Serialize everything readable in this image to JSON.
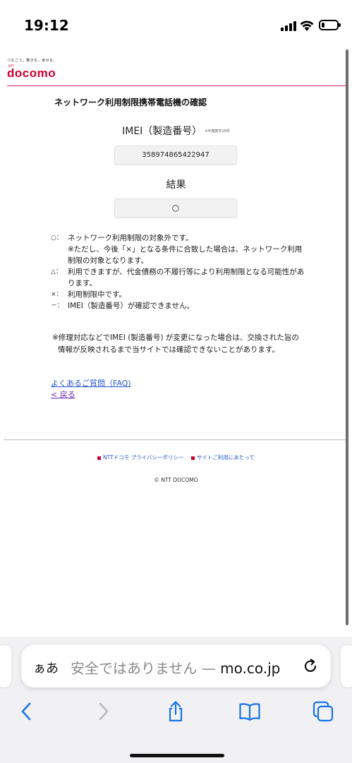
{
  "status_bar": {
    "time": "19:12",
    "battery_level": 0.22
  },
  "logo": {
    "tagline": "つなごう。驚きを。幸せを。",
    "small": "NTT",
    "wordmark": "docomo"
  },
  "page": {
    "title": "ネットワーク利用制限携帯電話機の確認",
    "imei_label": "IMEI（製造番号）",
    "imei_note": "※半角数字15桁",
    "imei_value": "358974865422947",
    "result_label": "結果",
    "result_value": "○",
    "legend": [
      {
        "mark": "○：",
        "text": "ネットワーク利用制限の対象外です。"
      },
      {
        "mark": "",
        "text": "※ただし、今後「×」となる条件に合致した場合は、ネットワーク利用制限の対象となります。"
      },
      {
        "mark": "△：",
        "text": "利用できますが、代金債務の不履行等により利用制限となる可能性があります。"
      },
      {
        "mark": "×：",
        "text": "利用制限中です。"
      },
      {
        "mark": "－：",
        "text": "IMEI（製造番号）が確認できません。"
      }
    ],
    "footnote": "※修理対応などでIMEI (製造番号) が変更になった場合は、交換された旨の情報が反映されるまで当サイトでは確認できないことがあります。",
    "faq_link": "よくあるご質問（FAQ)",
    "back_link": "< 戻る"
  },
  "footer": {
    "links": [
      "NTTドコモ プライバシーポリシー",
      "サイトご利用にあたって"
    ],
    "copyright": "© NTT DOCOMO"
  },
  "browser": {
    "aa_label": "ぁあ",
    "address_prefix": "安全ではありません — ",
    "address_domain": "mo.co.jp"
  },
  "icons": {
    "signal": "signal-icon",
    "wifi": "wifi-icon",
    "battery": "battery-icon",
    "reload": "reload-icon",
    "back": "chevron-left-icon",
    "forward": "chevron-right-icon",
    "share": "share-icon",
    "bookmarks": "book-icon",
    "tabs": "tabs-icon"
  },
  "colors": {
    "brand": "#cc0033",
    "link": "#2b57c9",
    "visited_link": "#6b2bb3",
    "toolbar_accent": "#1a73e8"
  }
}
